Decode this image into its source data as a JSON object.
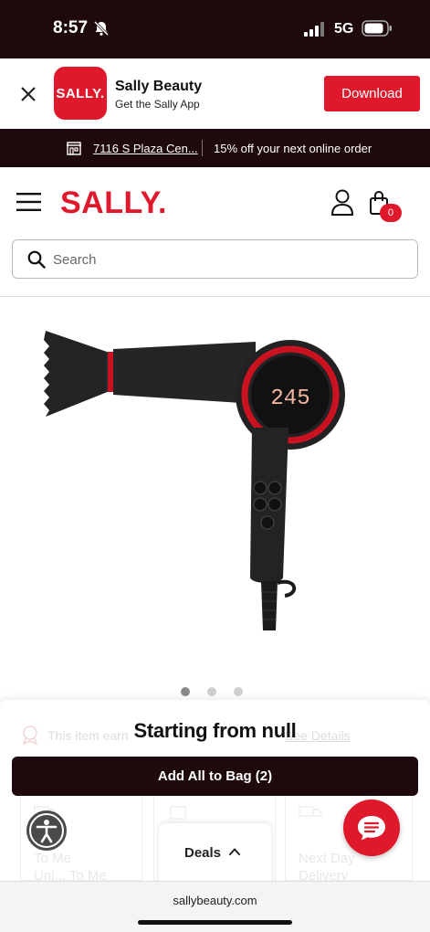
{
  "status_bar": {
    "time": "8:57",
    "network": "5G"
  },
  "app_banner": {
    "logo_text": "SALLY.",
    "app_name": "Sally Beauty",
    "app_subtitle": "Get the Sally App",
    "download_label": "Download"
  },
  "promo_bar": {
    "store_label": "7116 S Plaza Cen...",
    "promo_text": "15% off your next online order"
  },
  "header": {
    "logo_text": "SALLY.",
    "bag_count": "0",
    "search_placeholder": "Search"
  },
  "product": {
    "display_readout": "245",
    "carousel": {
      "total_images": 3,
      "active_index": 0
    }
  },
  "partially_hidden": {
    "earn_text": "This item earn",
    "details_link": "See Details"
  },
  "purchase": {
    "price_heading": "Starting from null",
    "add_to_bag_label": "Add All to Bag (2)"
  },
  "fulfillment": {
    "options": [
      {
        "line1": "To Me",
        "line2": "Uni... To Me"
      },
      {
        "line1": "",
        "line2": ""
      },
      {
        "line1": "Next Day",
        "line2": "Delivery"
      }
    ]
  },
  "deals_tab": {
    "label": "Deals"
  },
  "browser": {
    "url": "sallybeauty.com"
  },
  "colors": {
    "brand_red": "#e0182b",
    "dark_bar": "#1e0a0c"
  },
  "icons": [
    "bell-slash-icon",
    "signal-icon",
    "battery-icon",
    "close-icon",
    "store-icon",
    "menu-icon",
    "account-icon",
    "bag-icon",
    "search-icon",
    "accessibility-icon",
    "chat-icon",
    "chevron-up-icon"
  ]
}
